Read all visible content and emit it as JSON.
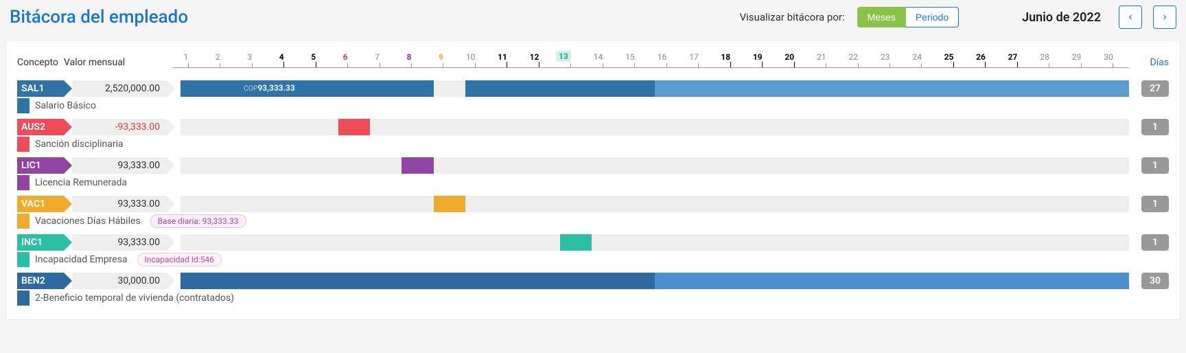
{
  "title": "Bitácora del empleado",
  "viewer": {
    "label": "Visualizar bitácora por:",
    "meses": "Meses",
    "periodo": "Periodo"
  },
  "month_label": "Junio de 2022",
  "header": {
    "concepto": "Concepto",
    "valor_mensual": "Valor mensual",
    "dias": "Días"
  },
  "days": [
    {
      "n": "1",
      "cls": ""
    },
    {
      "n": "2",
      "cls": ""
    },
    {
      "n": "3",
      "cls": ""
    },
    {
      "n": "4",
      "cls": "bold"
    },
    {
      "n": "5",
      "cls": "bold"
    },
    {
      "n": "6",
      "cls": "red"
    },
    {
      "n": "7",
      "cls": ""
    },
    {
      "n": "8",
      "cls": "purple"
    },
    {
      "n": "9",
      "cls": "orange"
    },
    {
      "n": "10",
      "cls": ""
    },
    {
      "n": "11",
      "cls": "bold"
    },
    {
      "n": "12",
      "cls": "bold"
    },
    {
      "n": "13",
      "cls": "teal"
    },
    {
      "n": "14",
      "cls": ""
    },
    {
      "n": "15",
      "cls": ""
    },
    {
      "n": "16",
      "cls": ""
    },
    {
      "n": "17",
      "cls": ""
    },
    {
      "n": "18",
      "cls": "bold"
    },
    {
      "n": "19",
      "cls": "bold"
    },
    {
      "n": "20",
      "cls": "bold"
    },
    {
      "n": "21",
      "cls": ""
    },
    {
      "n": "22",
      "cls": ""
    },
    {
      "n": "23",
      "cls": ""
    },
    {
      "n": "24",
      "cls": ""
    },
    {
      "n": "25",
      "cls": "bold"
    },
    {
      "n": "26",
      "cls": "bold"
    },
    {
      "n": "27",
      "cls": "bold"
    },
    {
      "n": "28",
      "cls": ""
    },
    {
      "n": "29",
      "cls": ""
    },
    {
      "n": "30",
      "cls": ""
    }
  ],
  "rows": [
    {
      "code": "SAL1",
      "chip": "chip-sal",
      "stripe": "ss-sal",
      "value": "2,520,000.00",
      "neg": false,
      "desc": "Salario Básico",
      "pill": null,
      "days": "27",
      "segments": [
        {
          "cls": "seg-dark",
          "from": 1,
          "to": 8
        },
        {
          "cls": "seg-dark",
          "from": 10,
          "to": 12
        },
        {
          "cls": "seg-dark",
          "from": 13,
          "to": 13
        },
        {
          "cls": "seg-dark",
          "from": 14,
          "to": 15
        },
        {
          "cls": "seg-light",
          "from": 16,
          "to": 30
        }
      ],
      "seg_label": {
        "cop": "COP",
        "amt": "93,333.33",
        "at": 3
      }
    },
    {
      "code": "AUS2",
      "chip": "chip-aus",
      "stripe": "ss-aus",
      "value": "-93,333.00",
      "neg": true,
      "desc": "Sanción disciplinaria",
      "pill": null,
      "days": "1",
      "segments": [
        {
          "cls": "seg-red",
          "from": 6,
          "to": 6
        }
      ]
    },
    {
      "code": "LIC1",
      "chip": "chip-lic",
      "stripe": "ss-lic",
      "value": "93,333.00",
      "neg": false,
      "desc": "Licencia Remunerada",
      "pill": null,
      "days": "1",
      "segments": [
        {
          "cls": "seg-purple",
          "from": 8,
          "to": 8
        }
      ]
    },
    {
      "code": "VAC1",
      "chip": "chip-vac",
      "stripe": "ss-vac",
      "value": "93,333.00",
      "neg": false,
      "desc": "Vacaciones Días Hábiles",
      "pill": {
        "text": "Base diaria: 93,333.33",
        "cls": "pill-purple"
      },
      "days": "1",
      "segments": [
        {
          "cls": "seg-orange",
          "from": 9,
          "to": 9
        }
      ]
    },
    {
      "code": "INC1",
      "chip": "chip-inc",
      "stripe": "ss-inc",
      "value": "93,333.00",
      "neg": false,
      "desc": "Incapacidad Empresa",
      "pill": {
        "text": "Incapacidad Id:546",
        "cls": "pill-pink"
      },
      "days": "1",
      "segments": [
        {
          "cls": "seg-teal",
          "from": 13,
          "to": 13
        }
      ]
    },
    {
      "code": "BEN2",
      "chip": "chip-ben",
      "stripe": "ss-ben",
      "value": "30,000.00",
      "neg": false,
      "desc": "2-Beneficio temporal de vivienda (contratados)",
      "pill": null,
      "days": "30",
      "segments": [
        {
          "cls": "seg-ben-d",
          "from": 1,
          "to": 15
        },
        {
          "cls": "seg-ben-l",
          "from": 16,
          "to": 30
        }
      ]
    }
  ],
  "chart_data": {
    "type": "table",
    "title": "Bitácora del empleado — Junio de 2022",
    "days_in_month": 30,
    "concepts": [
      {
        "code": "SAL1",
        "description": "Salario Básico",
        "monthly_value": 2520000.0,
        "daily_value": 93333.33,
        "days": 27,
        "covered_days": [
          1,
          2,
          3,
          4,
          5,
          6,
          7,
          8,
          10,
          11,
          12,
          13,
          14,
          15,
          16,
          17,
          18,
          19,
          20,
          21,
          22,
          23,
          24,
          25,
          26,
          27,
          28,
          29,
          30
        ]
      },
      {
        "code": "AUS2",
        "description": "Sanción disciplinaria",
        "monthly_value": -93333.0,
        "days": 1,
        "covered_days": [
          6
        ]
      },
      {
        "code": "LIC1",
        "description": "Licencia Remunerada",
        "monthly_value": 93333.0,
        "days": 1,
        "covered_days": [
          8
        ]
      },
      {
        "code": "VAC1",
        "description": "Vacaciones Días Hábiles",
        "monthly_value": 93333.0,
        "days": 1,
        "covered_days": [
          9
        ],
        "note": "Base diaria: 93,333.33"
      },
      {
        "code": "INC1",
        "description": "Incapacidad Empresa",
        "monthly_value": 93333.0,
        "days": 1,
        "covered_days": [
          13
        ],
        "note": "Incapacidad Id:546"
      },
      {
        "code": "BEN2",
        "description": "2-Beneficio temporal de vivienda (contratados)",
        "monthly_value": 30000.0,
        "days": 30,
        "covered_days": [
          1,
          2,
          3,
          4,
          5,
          6,
          7,
          8,
          9,
          10,
          11,
          12,
          13,
          14,
          15,
          16,
          17,
          18,
          19,
          20,
          21,
          22,
          23,
          24,
          25,
          26,
          27,
          28,
          29,
          30
        ]
      }
    ]
  }
}
